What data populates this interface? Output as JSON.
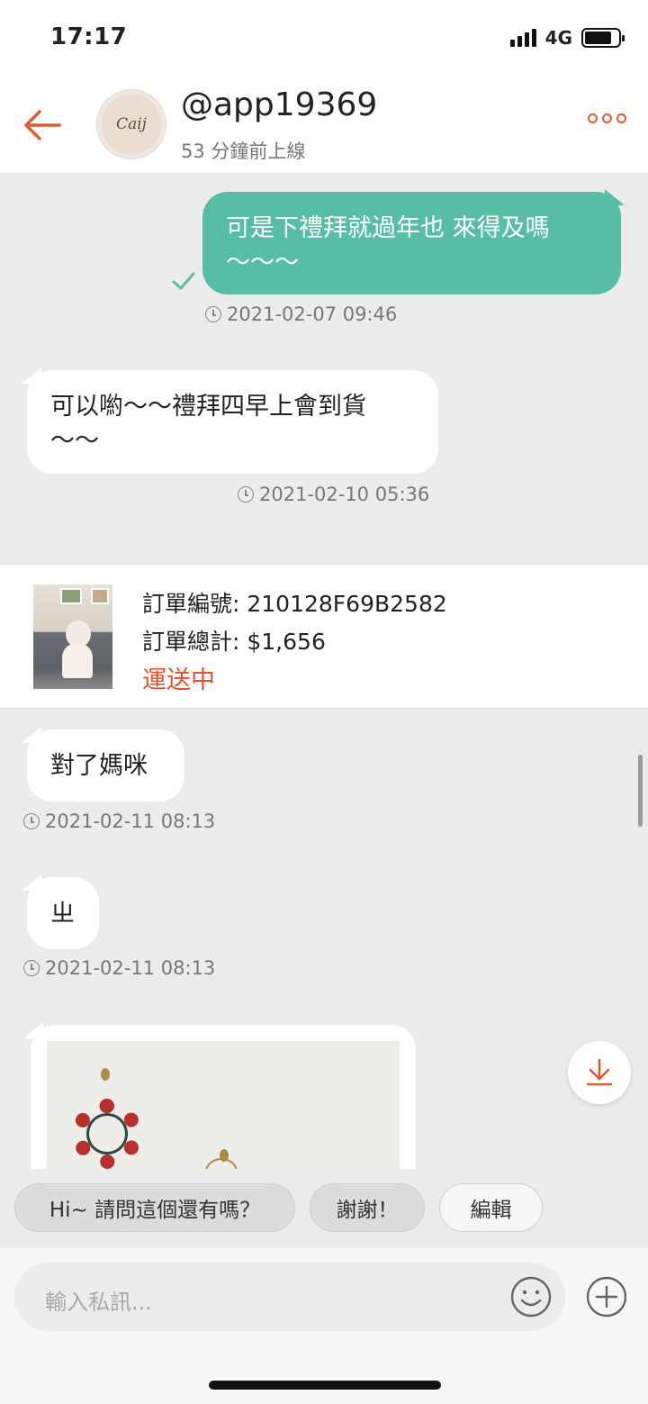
{
  "status_bar": {
    "time": "17:17",
    "network": "4G",
    "battery_level": 0.8
  },
  "header": {
    "username": "@app19369",
    "online_status": "53 分鐘前上線",
    "avatar_text": "Caij",
    "accent_color": "#e05a33"
  },
  "messages": [
    {
      "direction": "outgoing",
      "line1": "可是下禮拜就過年也 來得及嗎",
      "line2": "～～～",
      "timestamp": "2021-02-07 09:46"
    },
    {
      "direction": "incoming",
      "line1": "可以喲～～禮拜四早上會到貨",
      "line2": "～～",
      "timestamp": "2021-02-10 05:36"
    },
    {
      "direction": "incoming",
      "line1": "對了媽咪",
      "timestamp": "2021-02-11 08:13"
    },
    {
      "direction": "incoming",
      "line1": "ㄓ",
      "timestamp": "2021-02-11 08:13"
    }
  ],
  "order": {
    "number_label": "訂單編號: 210128F69B2582",
    "total_label": "訂單總計: $1,656",
    "status": "運送中",
    "status_color": "#e2502c"
  },
  "quick_replies": [
    "Hi~ 請問這個還有嗎？",
    "謝謝！",
    "編輯"
  ],
  "composer": {
    "placeholder": "輸入私訊..."
  },
  "colors": {
    "outgoing_bubble": "#57bda5",
    "background": "#ececec"
  }
}
